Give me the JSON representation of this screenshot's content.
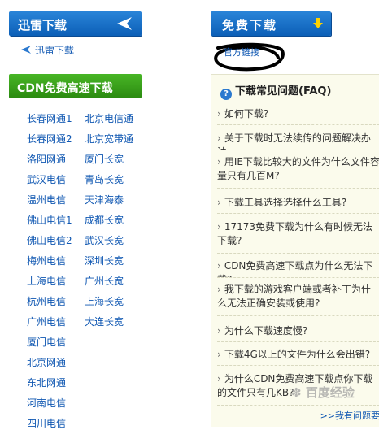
{
  "left": {
    "xunlei_header": "迅雷下载",
    "xunlei_link": "迅雷下载",
    "cdn_header": "CDN免费高速下载",
    "cdn_col1": [
      "长春网通1",
      "长春网通2",
      "洛阳网通",
      "武汉电信",
      "温州电信",
      "佛山电信1",
      "佛山电信2",
      "梅州电信",
      "上海电信",
      "杭州电信",
      "广州电信",
      "厦门电信",
      "北京网通",
      "东北网通",
      "河南电信",
      "四川电信"
    ],
    "cdn_col2": [
      "北京电信通",
      "北京宽带通",
      "厦门长宽",
      "青岛长宽",
      "天津海泰",
      "成都长宽",
      "武汉长宽",
      "深圳长宽",
      "广州长宽",
      "上海长宽",
      "大连长宽"
    ]
  },
  "right": {
    "free_header": "免费下载",
    "official_link": "官方链接",
    "faq_title": "下载常见问题(FAQ)",
    "faq_items": [
      "如何下载?",
      "关于下载时无法续传的问题解决办法",
      "用IE下载比较大的文件为什么文件容量只有几百M?",
      "下载工具选择选择什么工具?",
      "17173免费下载为什么有时候无法下载?",
      "CDN免费高速下载点为什么无法下载?",
      "我下载的游戏客户端或者补丁为什么无法正确安装或使用?",
      "为什么下载速度慢?",
      "下载4G以上的文件为什么会出错?",
      "为什么CDN免费高速下载点你下载的文件只有几KB?"
    ],
    "faq_more": ">>我有问题要",
    "watermark": "百度经验"
  },
  "colors": {
    "blue_button": "#1670c8",
    "green_button": "#3aa01a",
    "link": "#0f57b2",
    "faq_bg": "#fbfbec"
  }
}
